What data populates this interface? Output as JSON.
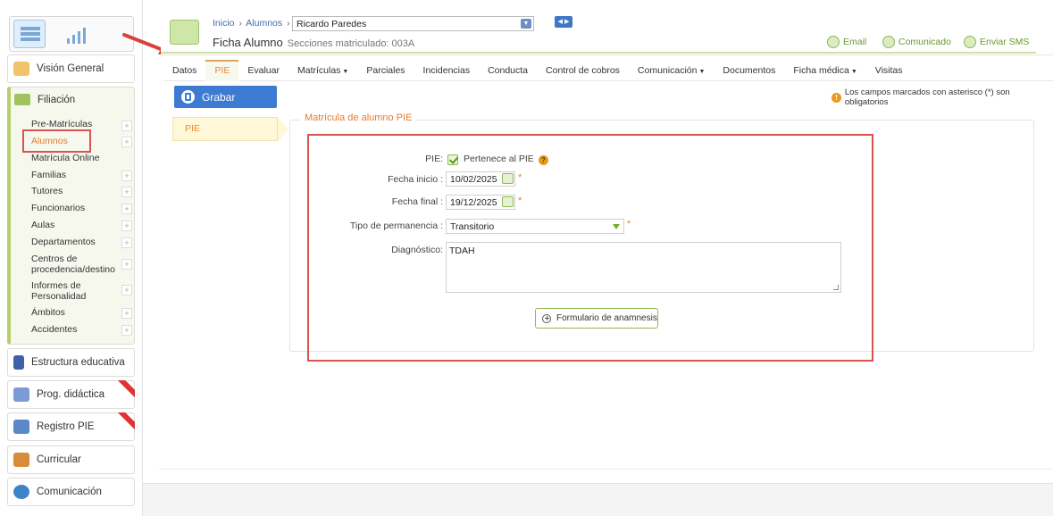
{
  "sidebar": {
    "sections": {
      "vision_general": "Visión General",
      "filiacion": "Filiación",
      "estructura": "Estructura educativa",
      "prog": "Prog. didáctica",
      "registro": "Registro PIE",
      "curricular": "Curricular",
      "comunicacion": "Comunicación"
    },
    "items": [
      {
        "label": "Pre-Matrículas"
      },
      {
        "label": "Alumnos"
      },
      {
        "label": "Matrícula Online"
      },
      {
        "label": "Familias"
      },
      {
        "label": "Tutores"
      },
      {
        "label": "Funcionarios"
      },
      {
        "label": "Aulas"
      },
      {
        "label": "Departamentos"
      },
      {
        "label": "Centros de procedencia/destino"
      },
      {
        "label": "Informes de Personalidad"
      },
      {
        "label": "Ámbitos"
      },
      {
        "label": "Accidentes"
      }
    ]
  },
  "header": {
    "breadcrumb": [
      "Inicio",
      "Alumnos"
    ],
    "student": "Ricardo Paredes",
    "title": "Ficha Alumno",
    "subtitle": "Secciones matriculado: 003A",
    "actions": {
      "email": "Email",
      "comunicado": "Comunicado",
      "sms": "Enviar SMS"
    }
  },
  "tabs": [
    {
      "label": "Datos"
    },
    {
      "label": "PIE"
    },
    {
      "label": "Evaluar"
    },
    {
      "label": "Matrículas"
    },
    {
      "label": "Parciales"
    },
    {
      "label": "Incidencias"
    },
    {
      "label": "Conducta"
    },
    {
      "label": "Control de cobros"
    },
    {
      "label": "Comunicación"
    },
    {
      "label": "Documentos"
    },
    {
      "label": "Ficha médica"
    },
    {
      "label": "Visitas"
    }
  ],
  "toolbar": {
    "grabar": "Grabar"
  },
  "notice": "Los campos marcados con asterisco (*) son obligatorios",
  "side_tab": "PIE",
  "form": {
    "legend": "Matrícula de alumno PIE",
    "pie_label": "PIE:",
    "pie_checkbox_label": "Pertenece al PIE",
    "fecha_inicio_label": "Fecha inicio :",
    "fecha_inicio": "10/02/2025",
    "fecha_final_label": "Fecha final :",
    "fecha_final": "19/12/2025",
    "tipo_label": "Tipo de permanencia :",
    "tipo_value": "Transitorio",
    "diag_label": "Diagnóstico:",
    "diag_value": "TDAH",
    "anamnesis_button": "Formulario de anamnesis",
    "required_mark": "*"
  },
  "colors": {
    "accent": "#3d7ad1",
    "orange": "#e47c2e",
    "highlight_red": "#d9534f",
    "green": "#8fb854"
  }
}
